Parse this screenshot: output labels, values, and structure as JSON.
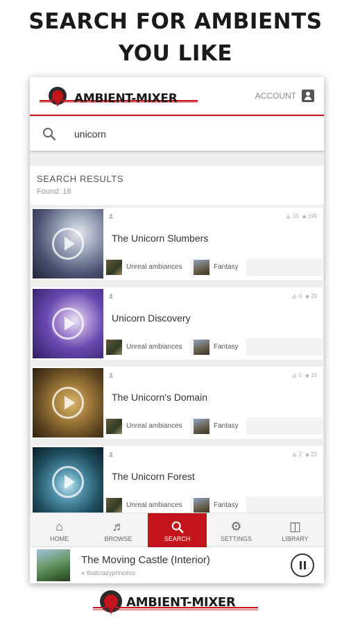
{
  "headline": {
    "line1": "SEARCH FOR AMBIENTS",
    "line2": "YOU LIKE"
  },
  "header": {
    "logo_text": "AMBIENT-MIXER",
    "account_label": "ACCOUNT"
  },
  "search": {
    "value": "unicorn"
  },
  "results": {
    "title": "SEARCH RESULTS",
    "found": "Found: 18",
    "items": [
      {
        "title": "The Unicorn Slumbers",
        "likes": "10",
        "views": "199",
        "tag1": "Unreal ambiances",
        "tag2": "Fantasy"
      },
      {
        "title": "Unicorn Discovery",
        "likes": "0",
        "views": "29",
        "tag1": "Unreal ambiances",
        "tag2": "Fantasy"
      },
      {
        "title": "The Unicorn's Domain",
        "likes": "0",
        "views": "10",
        "tag1": "Unreal ambiances",
        "tag2": "Fantasy"
      },
      {
        "title": "The Unicorn Forest",
        "likes": "2",
        "views": "23",
        "tag1": "Unreal ambiances",
        "tag2": "Fantasy"
      }
    ]
  },
  "nav": {
    "items": [
      {
        "label": "HOME",
        "icon": "home-icon"
      },
      {
        "label": "BROWSE",
        "icon": "queue-music-icon"
      },
      {
        "label": "SEARCH",
        "icon": "search-icon"
      },
      {
        "label": "SETTINGS",
        "icon": "gear-icon"
      },
      {
        "label": "LIBRARY",
        "icon": "library-music-icon"
      }
    ],
    "active_index": 2
  },
  "player": {
    "title": "The Moving Castle (Interior)",
    "user": "thatcrazyprincess"
  },
  "footer": {
    "logo_text": "AMBIENT-MIXER"
  },
  "colors": {
    "accent": "#c4141b"
  }
}
